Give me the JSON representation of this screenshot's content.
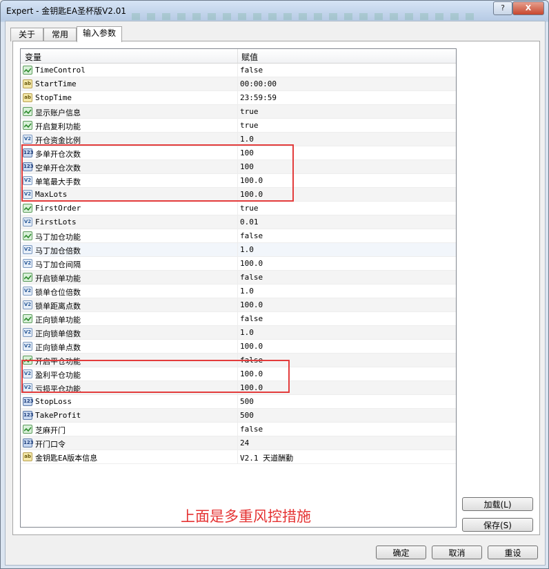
{
  "window": {
    "title": "Expert - 金钥匙EA圣杯版V2.01",
    "help_label": "?",
    "close_label": "X"
  },
  "tabs": [
    {
      "label": "关于"
    },
    {
      "label": "常用"
    },
    {
      "label": "输入参数",
      "active": true
    }
  ],
  "grid": {
    "headers": {
      "variable": "变量",
      "value": "赋值"
    },
    "rows": [
      {
        "name": "TimeControl",
        "value": "false",
        "type": "bool"
      },
      {
        "name": "StartTime",
        "value": "00:00:00",
        "type": "string"
      },
      {
        "name": "StopTime",
        "value": "23:59:59",
        "type": "string"
      },
      {
        "name": "显示账户信息",
        "value": "true",
        "type": "bool"
      },
      {
        "name": "开启复利功能",
        "value": "true",
        "type": "bool"
      },
      {
        "name": "开仓资金比例",
        "value": "1.0",
        "type": "double"
      },
      {
        "name": "多单开仓次数",
        "value": "100",
        "type": "int"
      },
      {
        "name": "空单开仓次数",
        "value": "100",
        "type": "int"
      },
      {
        "name": "单笔最大手数",
        "value": "100.0",
        "type": "double"
      },
      {
        "name": "MaxLots",
        "value": "100.0",
        "type": "double"
      },
      {
        "name": "FirstOrder",
        "value": "true",
        "type": "bool"
      },
      {
        "name": "FirstLots",
        "value": "0.01",
        "type": "double"
      },
      {
        "name": "马丁加仓功能",
        "value": "false",
        "type": "bool"
      },
      {
        "name": "马丁加仓倍数",
        "value": "1.0",
        "type": "double"
      },
      {
        "name": "马丁加仓间隔",
        "value": "100.0",
        "type": "double"
      },
      {
        "name": "开启锁单功能",
        "value": "false",
        "type": "bool"
      },
      {
        "name": "锁单仓位倍数",
        "value": "1.0",
        "type": "double"
      },
      {
        "name": "锁单距离点数",
        "value": "100.0",
        "type": "double"
      },
      {
        "name": "正向锁单功能",
        "value": "false",
        "type": "bool"
      },
      {
        "name": "正向锁单倍数",
        "value": "1.0",
        "type": "double"
      },
      {
        "name": "正向锁单点数",
        "value": "100.0",
        "type": "double"
      },
      {
        "name": "开启平仓功能",
        "value": "false",
        "type": "bool"
      },
      {
        "name": "盈利平仓功能",
        "value": "100.0",
        "type": "double"
      },
      {
        "name": "亏损平仓功能",
        "value": "100.0",
        "type": "double"
      },
      {
        "name": "StopLoss",
        "value": "500",
        "type": "int"
      },
      {
        "name": "TakeProfit",
        "value": "500",
        "type": "int"
      },
      {
        "name": "芝麻开门",
        "value": "false",
        "type": "bool"
      },
      {
        "name": "开门口令",
        "value": "24",
        "type": "int"
      },
      {
        "name": "金钥匙EA版本信息",
        "value": "V2.1 天道酬勤",
        "type": "string"
      }
    ],
    "type_icons": {
      "bool": "bool-icon",
      "string": "string-icon",
      "int": "integer-icon",
      "double": "double-icon"
    },
    "icon_text": {
      "string": "ab",
      "int": "123",
      "double": "V2"
    }
  },
  "annotation": {
    "text": "上面是多重风控措施",
    "color": "#e53333"
  },
  "buttons": {
    "load": "加载(L)",
    "save": "保存(S)",
    "ok": "确定",
    "cancel": "取消",
    "reset": "重设"
  }
}
